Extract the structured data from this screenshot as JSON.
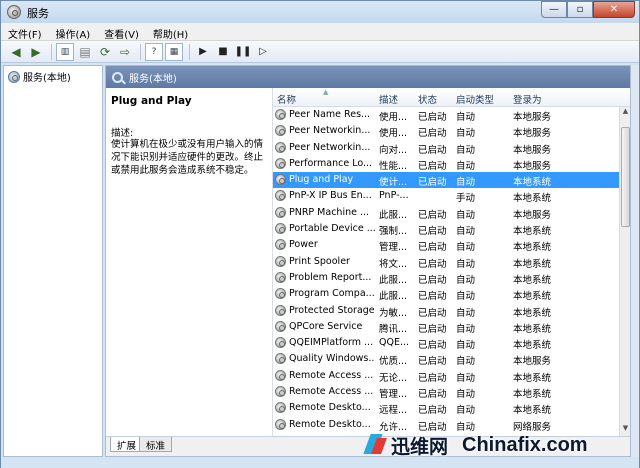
{
  "window": {
    "title": "服务",
    "btn_min": "—",
    "btn_max": "▫",
    "btn_close": "✕"
  },
  "menu": [
    "文件(F)",
    "操作(A)",
    "查看(V)",
    "帮助(H)"
  ],
  "tree": {
    "root_label": "服务(本地)"
  },
  "pane_header": "服务(本地)",
  "detail": {
    "title": "Plug and Play",
    "label": "描述:",
    "text": "使计算机在极少或没有用户输入的情况下能识别并适应硬件的更改。终止或禁用此服务会造成系统不稳定。"
  },
  "columns": {
    "name": "名称",
    "desc": "描述",
    "status": "状态",
    "startup": "启动类型",
    "logon": "登录为"
  },
  "rows": [
    {
      "name": "Peer Name Res...",
      "desc": "使用...",
      "status": "已启动",
      "startup": "自动",
      "logon": "本地服务"
    },
    {
      "name": "Peer Networkin...",
      "desc": "使用...",
      "status": "已启动",
      "startup": "自动",
      "logon": "本地服务"
    },
    {
      "name": "Peer Networkin...",
      "desc": "向对...",
      "status": "已启动",
      "startup": "自动",
      "logon": "本地服务"
    },
    {
      "name": "Performance Lo...",
      "desc": "性能...",
      "status": "已启动",
      "startup": "自动",
      "logon": "本地服务"
    },
    {
      "name": "Plug and Play",
      "desc": "使计...",
      "status": "已启动",
      "startup": "自动",
      "logon": "本地系统",
      "selected": true
    },
    {
      "name": "PnP-X IP Bus En...",
      "desc": "PnP-...",
      "status": "",
      "startup": "手动",
      "logon": "本地系统"
    },
    {
      "name": "PNRP Machine ...",
      "desc": "此服...",
      "status": "已启动",
      "startup": "自动",
      "logon": "本地服务"
    },
    {
      "name": "Portable Device ...",
      "desc": "强制...",
      "status": "已启动",
      "startup": "自动",
      "logon": "本地系统"
    },
    {
      "name": "Power",
      "desc": "管理...",
      "status": "已启动",
      "startup": "自动",
      "logon": "本地系统"
    },
    {
      "name": "Print Spooler",
      "desc": "将文...",
      "status": "已启动",
      "startup": "自动",
      "logon": "本地系统"
    },
    {
      "name": "Problem Report...",
      "desc": "此服...",
      "status": "已启动",
      "startup": "自动",
      "logon": "本地系统"
    },
    {
      "name": "Program Compa...",
      "desc": "此服...",
      "status": "已启动",
      "startup": "自动",
      "logon": "本地系统"
    },
    {
      "name": "Protected Storage",
      "desc": "为敏...",
      "status": "已启动",
      "startup": "自动",
      "logon": "本地系统"
    },
    {
      "name": "QPCore Service",
      "desc": "腾讯...",
      "status": "已启动",
      "startup": "自动",
      "logon": "本地系统"
    },
    {
      "name": "QQEIMPlatform ...",
      "desc": "QQE...",
      "status": "已启动",
      "startup": "自动",
      "logon": "本地系统"
    },
    {
      "name": "Quality Windows...",
      "desc": "优质...",
      "status": "已启动",
      "startup": "自动",
      "logon": "本地服务"
    },
    {
      "name": "Remote Access ...",
      "desc": "无论...",
      "status": "已启动",
      "startup": "自动",
      "logon": "本地系统"
    },
    {
      "name": "Remote Access ...",
      "desc": "管理...",
      "status": "已启动",
      "startup": "自动",
      "logon": "本地系统"
    },
    {
      "name": "Remote Deskto...",
      "desc": "远程...",
      "status": "已启动",
      "startup": "自动",
      "logon": "本地系统"
    },
    {
      "name": "Remote Deskto...",
      "desc": "允许...",
      "status": "已启动",
      "startup": "自动",
      "logon": "网络服务"
    }
  ],
  "tabs": {
    "extended": "扩展",
    "standard": "标准"
  },
  "watermark": {
    "cn": "迅维网",
    "en": "Chinafix.com"
  }
}
